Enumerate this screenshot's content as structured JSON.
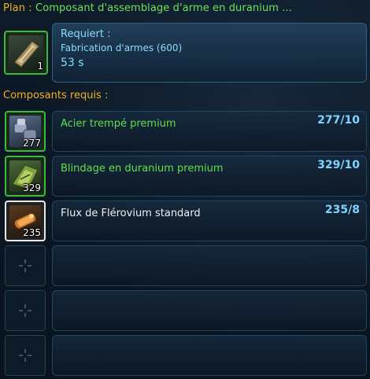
{
  "plan": {
    "label": "Plan :",
    "name": "Composant d'assemblage d'arme en duranium ...",
    "result_count": "1"
  },
  "requirement": {
    "title": "Requiert :",
    "skill": "Fabrication d'armes (600)",
    "time": "53 s"
  },
  "components_heading": "Composants requis :",
  "components": [
    {
      "name": "Acier trempé premium",
      "slot_count": "277",
      "qty": "277/10",
      "rarity": "premium",
      "icon": "steel-icon"
    },
    {
      "name": "Blindage en duranium premium",
      "slot_count": "329",
      "qty": "329/10",
      "rarity": "premium",
      "icon": "armor-plating-icon"
    },
    {
      "name": "Flux de Flérovium standard",
      "slot_count": "235",
      "qty": "235/8",
      "rarity": "standard",
      "icon": "flerovium-flux-icon"
    }
  ],
  "empty_slots": 3,
  "colors": {
    "orange": "#f2b01e",
    "green": "#5fe04a",
    "cyan": "#88ddff",
    "qty_blue": "#7fd4ff"
  }
}
